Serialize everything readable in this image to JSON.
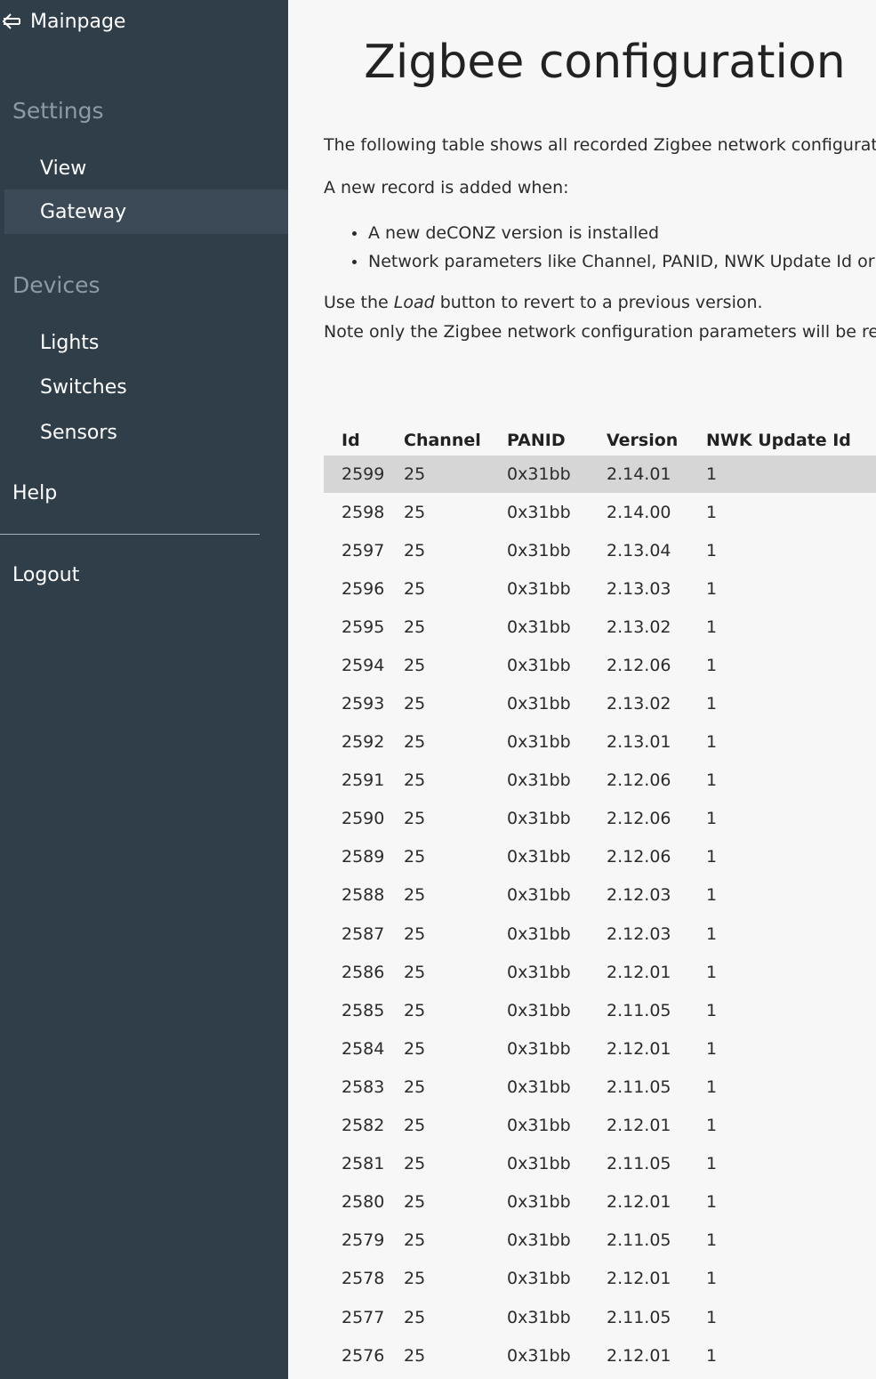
{
  "sidebar": {
    "mainpage_label": "Mainpage",
    "settings_heading": "Settings",
    "settings_items": [
      {
        "label": "View"
      },
      {
        "label": "Gateway"
      }
    ],
    "devices_heading": "Devices",
    "devices_items": [
      {
        "label": "Lights"
      },
      {
        "label": "Switches"
      },
      {
        "label": "Sensors"
      }
    ],
    "help_label": "Help",
    "logout_label": "Logout",
    "active_item": "Gateway"
  },
  "main": {
    "title": "Zigbee configuration",
    "intro": "The following table shows all recorded Zigbee network configuratio",
    "record_added": "A new record is added when:",
    "bullets": [
      "A new deCONZ version is installed",
      "Network parameters like Channel, PANID, NWK Update Id or"
    ],
    "load_prefix": "Use the ",
    "load_word": "Load",
    "load_suffix": " button to revert to a previous version.",
    "note": "Note only the Zigbee network configuration parameters will be rest"
  },
  "table": {
    "headers": [
      "Id",
      "Channel",
      "PANID",
      "Version",
      "NWK Update Id"
    ],
    "rows": [
      [
        "2599",
        "25",
        "0x31bb",
        "2.14.01",
        "1"
      ],
      [
        "2598",
        "25",
        "0x31bb",
        "2.14.00",
        "1"
      ],
      [
        "2597",
        "25",
        "0x31bb",
        "2.13.04",
        "1"
      ],
      [
        "2596",
        "25",
        "0x31bb",
        "2.13.03",
        "1"
      ],
      [
        "2595",
        "25",
        "0x31bb",
        "2.13.02",
        "1"
      ],
      [
        "2594",
        "25",
        "0x31bb",
        "2.12.06",
        "1"
      ],
      [
        "2593",
        "25",
        "0x31bb",
        "2.13.02",
        "1"
      ],
      [
        "2592",
        "25",
        "0x31bb",
        "2.13.01",
        "1"
      ],
      [
        "2591",
        "25",
        "0x31bb",
        "2.12.06",
        "1"
      ],
      [
        "2590",
        "25",
        "0x31bb",
        "2.12.06",
        "1"
      ],
      [
        "2589",
        "25",
        "0x31bb",
        "2.12.06",
        "1"
      ],
      [
        "2588",
        "25",
        "0x31bb",
        "2.12.03",
        "1"
      ],
      [
        "2587",
        "25",
        "0x31bb",
        "2.12.03",
        "1"
      ],
      [
        "2586",
        "25",
        "0x31bb",
        "2.12.01",
        "1"
      ],
      [
        "2585",
        "25",
        "0x31bb",
        "2.11.05",
        "1"
      ],
      [
        "2584",
        "25",
        "0x31bb",
        "2.12.01",
        "1"
      ],
      [
        "2583",
        "25",
        "0x31bb",
        "2.11.05",
        "1"
      ],
      [
        "2582",
        "25",
        "0x31bb",
        "2.12.01",
        "1"
      ],
      [
        "2581",
        "25",
        "0x31bb",
        "2.11.05",
        "1"
      ],
      [
        "2580",
        "25",
        "0x31bb",
        "2.12.01",
        "1"
      ],
      [
        "2579",
        "25",
        "0x31bb",
        "2.11.05",
        "1"
      ],
      [
        "2578",
        "25",
        "0x31bb",
        "2.12.01",
        "1"
      ],
      [
        "2577",
        "25",
        "0x31bb",
        "2.11.05",
        "1"
      ],
      [
        "2576",
        "25",
        "0x31bb",
        "2.12.01",
        "1"
      ]
    ],
    "highlighted_row": "2599"
  },
  "colors": {
    "sidebar_bg": "#2f3e49",
    "sidebar_active": "#3b4a56",
    "heading_muted": "#8e9aa3",
    "main_bg": "#f7f7f7",
    "row_highlight": "#d6d6d6"
  },
  "icons": {
    "mainpage": "arrow-left-icon"
  }
}
